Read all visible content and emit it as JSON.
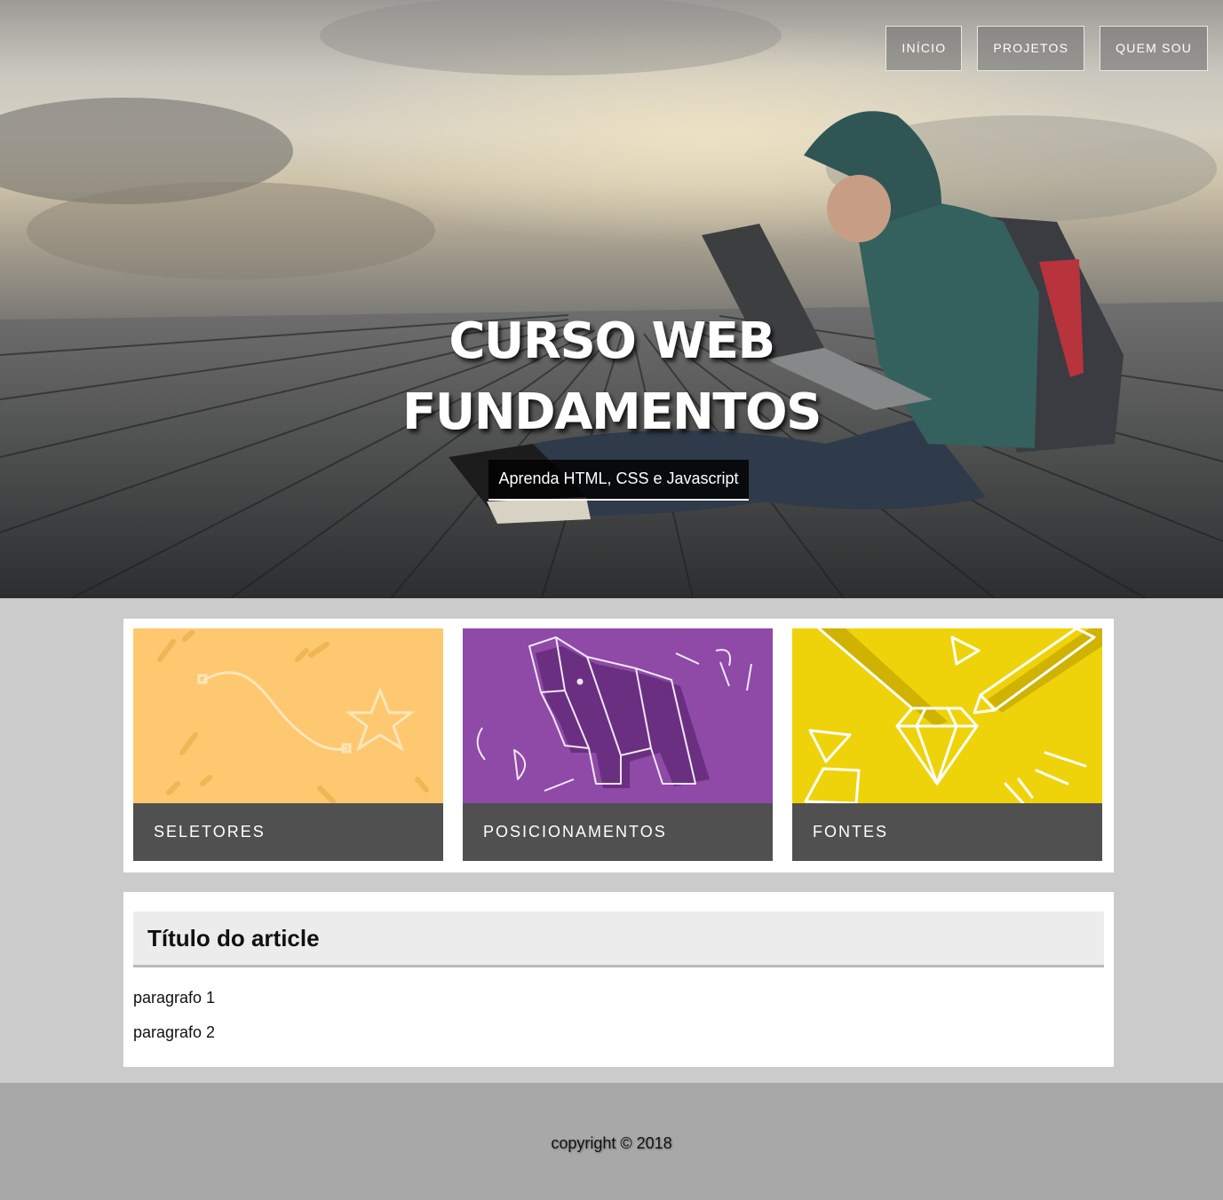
{
  "nav": {
    "items": [
      {
        "label": "INÍCIO"
      },
      {
        "label": "PROJETOS"
      },
      {
        "label": "QUEM SOU"
      }
    ]
  },
  "hero": {
    "title_line1": "CURSO WEB",
    "title_line2": "FUNDAMENTOS",
    "subtitle": "Aprenda HTML, CSS e Javascript"
  },
  "cards": [
    {
      "label": "SELETORES",
      "color": "#fec870",
      "icon": "bezier-star-illustration"
    },
    {
      "label": "POSICIONAMENTOS",
      "color": "#8e4aa6",
      "icon": "origami-elephant-illustration"
    },
    {
      "label": "FONTES",
      "color": "#efd30a",
      "icon": "diamond-pencil-illustration"
    }
  ],
  "article": {
    "title": "Título do article",
    "paragraphs": [
      "paragrafo 1",
      "paragrafo 2"
    ]
  },
  "footer": {
    "copyright": "copyright © 2018"
  }
}
